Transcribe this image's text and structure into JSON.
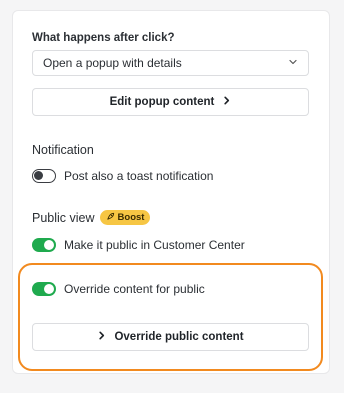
{
  "click_action": {
    "label": "What happens after click?",
    "selected": "Open a popup with details",
    "edit_button": "Edit popup content"
  },
  "notification": {
    "title": "Notification",
    "toast_toggle_label": "Post also a toast notification",
    "toast_enabled": false
  },
  "public_view": {
    "title": "Public view",
    "badge": "Boost",
    "public_toggle_label": "Make it public in Customer Center",
    "public_enabled": true,
    "override_toggle_label": "Override content for public",
    "override_enabled": true,
    "override_button": "Override public content"
  },
  "colors": {
    "toggle_on": "#1faa4e",
    "boost_badge": "#f6c644",
    "highlight_border": "#f28a1f"
  }
}
